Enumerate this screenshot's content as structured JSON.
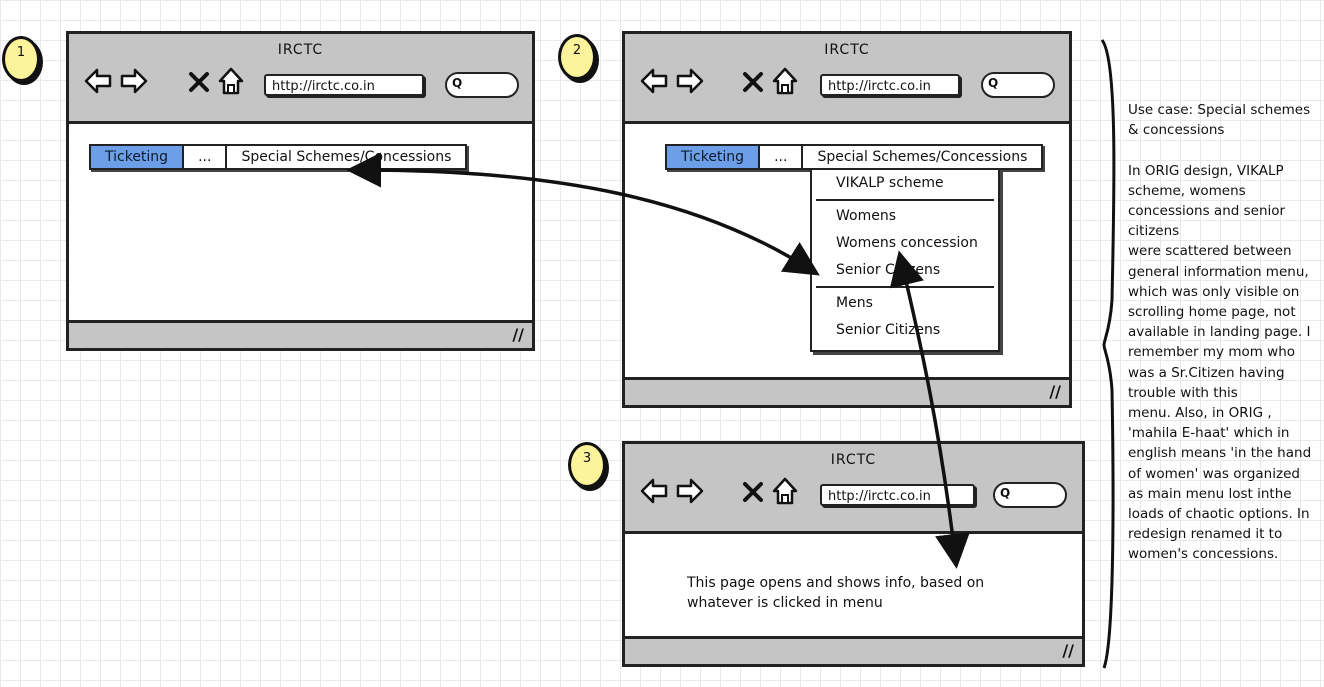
{
  "badges": [
    "1",
    "2",
    "3"
  ],
  "browser": {
    "title": "IRCTC",
    "url": "http://irctc.co.in"
  },
  "tabs": [
    "Ticketing",
    "...",
    "Special Schemes/Concessions"
  ],
  "menu": {
    "group1": [
      "VIKALP scheme"
    ],
    "group2": [
      "Womens",
      "Womens concession",
      "Senior Citizens"
    ],
    "group3": [
      "Mens",
      "Senior Citizens"
    ]
  },
  "window3_text": "This page opens and shows info, based on whatever is clicked in menu",
  "note": "Use case: Special schemes & concessions\n\nIn ORIG design, VIKALP scheme, womens concessions and senior citizens\nwere scattered between general information menu, which was only visible on scrolling home page, not available in landing page. I remember my mom who was a Sr.Citizen having trouble with this\nmenu. Also, in ORIG , 'mahila E-haat' which in english means 'in the hand of women' was organized as main menu lost inthe loads of chaotic options. In redesign renamed it to women's concessions.",
  "colors": {
    "badge": "#fdf39a",
    "chrome": "#c5c5c5",
    "active_tab": "#6d9ee8"
  }
}
